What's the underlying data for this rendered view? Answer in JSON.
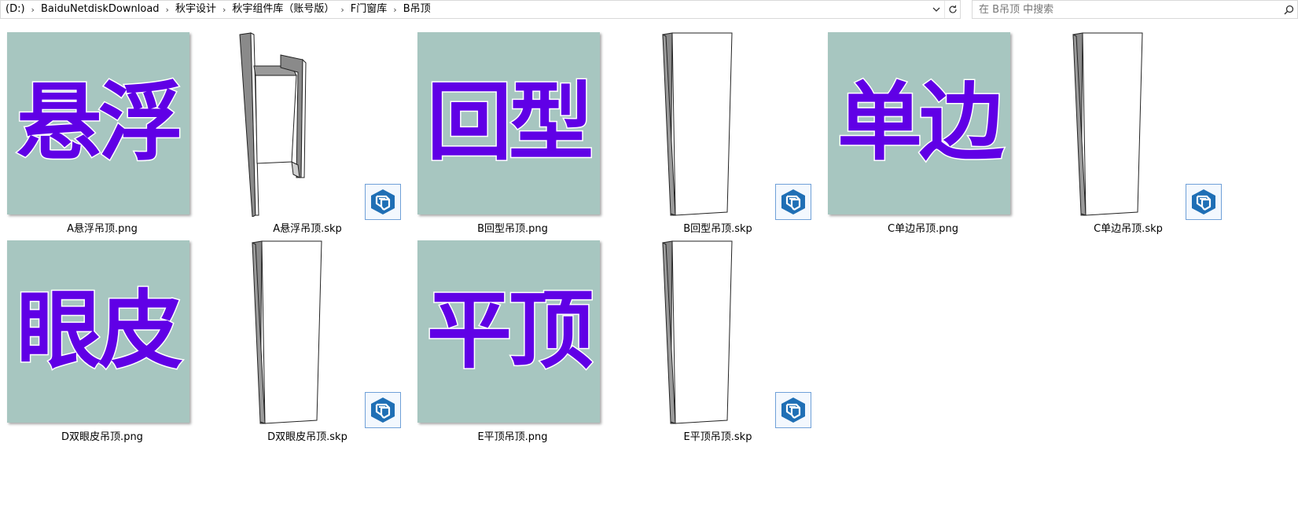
{
  "address_bar": {
    "crumbs": [
      "(D:)",
      "BaiduNetdiskDownload",
      "秋宇设计",
      "秋宇组件库（账号版）",
      "F门窗库",
      "B吊顶"
    ]
  },
  "search": {
    "placeholder": "在 B吊顶 中搜索"
  },
  "files": [
    {
      "name": "A悬浮吊顶.png",
      "type": "png",
      "thumb_text": "悬浮"
    },
    {
      "name": "A悬浮吊顶.skp",
      "type": "skp",
      "model": "floating"
    },
    {
      "name": "B回型吊顶.png",
      "type": "png",
      "thumb_text": "回型"
    },
    {
      "name": "B回型吊顶.skp",
      "type": "skp",
      "model": "panel"
    },
    {
      "name": "C单边吊顶.png",
      "type": "png",
      "thumb_text": "单边"
    },
    {
      "name": "C单边吊顶.skp",
      "type": "skp",
      "model": "panel"
    },
    {
      "name": "D双眼皮吊顶.png",
      "type": "png",
      "thumb_text": "眼皮"
    },
    {
      "name": "D双眼皮吊顶.skp",
      "type": "skp",
      "model": "panel"
    },
    {
      "name": "E平顶吊顶.png",
      "type": "png",
      "thumb_text": "平顶"
    },
    {
      "name": "E平顶吊顶.skp",
      "type": "skp",
      "model": "panel"
    }
  ],
  "colors": {
    "thumb_bg": "#a7c6c0",
    "thumb_text": "#6000e6",
    "sketchup_blue": "#1f6fb5"
  },
  "icons": {
    "sketchup": "sketchup-logo-icon",
    "search": "search-icon",
    "refresh": "refresh-icon",
    "dropdown": "chevron-down-icon"
  }
}
